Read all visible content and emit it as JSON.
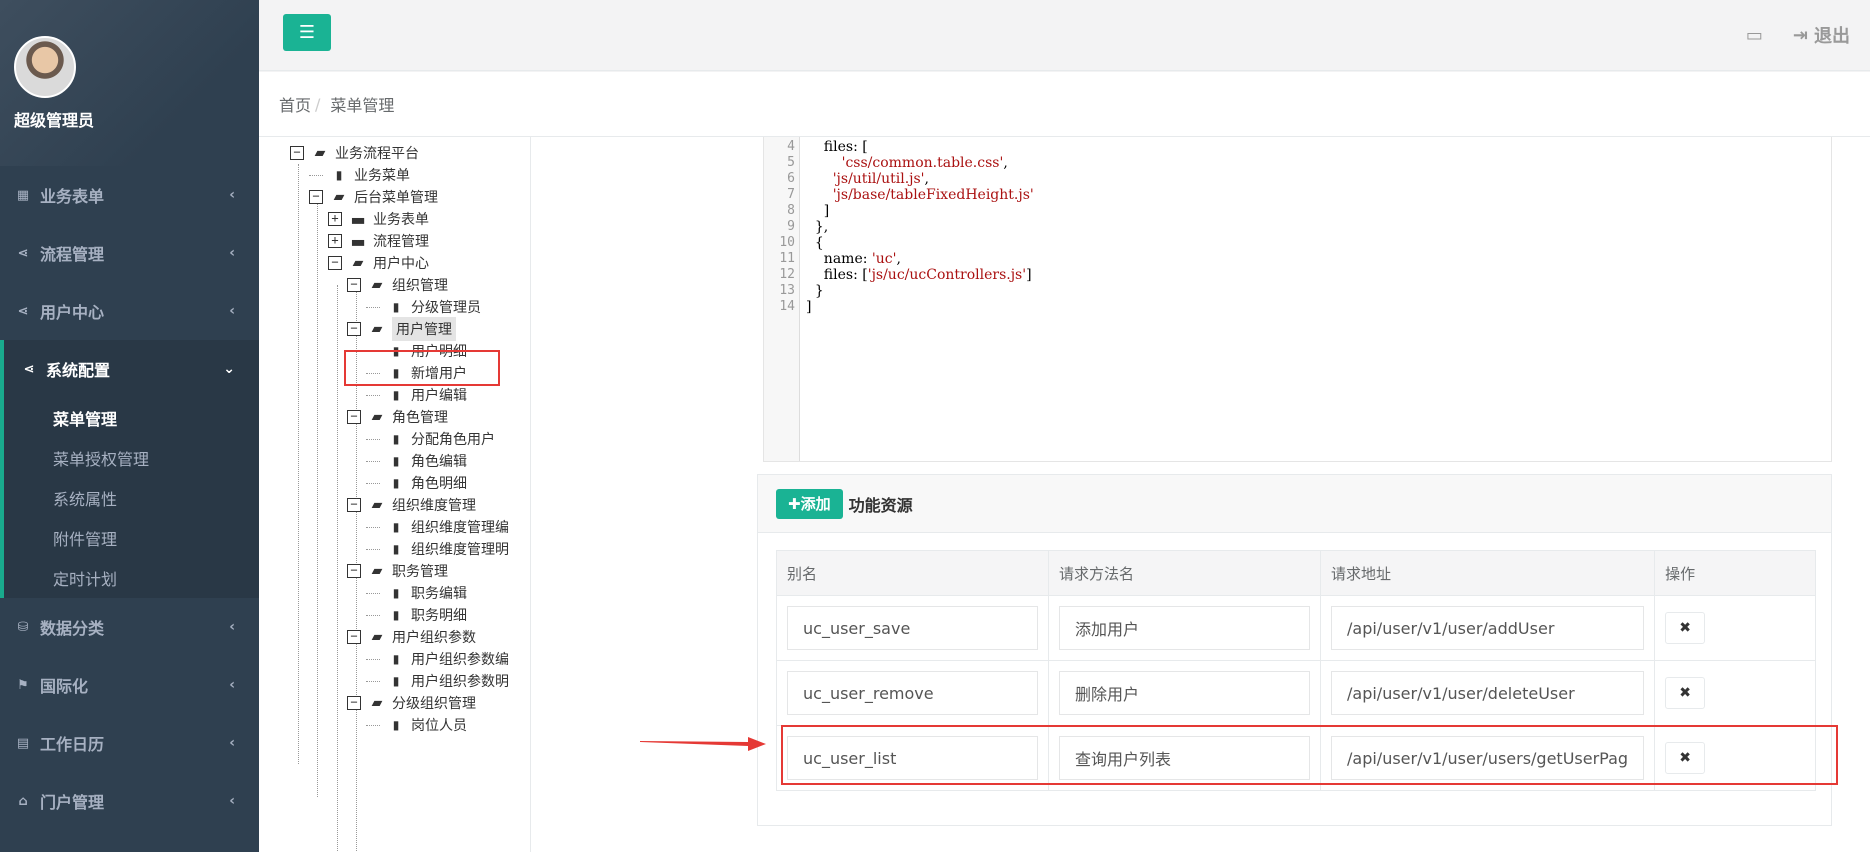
{
  "user": {
    "name": "超级管理员"
  },
  "sidebar": {
    "items": [
      {
        "label": "业务表单",
        "icon": "▦",
        "icon_name": "table-icon"
      },
      {
        "label": "流程管理",
        "icon": "⋖",
        "icon_name": "share-icon"
      },
      {
        "label": "用户中心",
        "icon": "⋖",
        "icon_name": "share-icon"
      },
      {
        "label": "系统配置",
        "icon": "⋖",
        "icon_name": "share-icon",
        "active": true,
        "children": [
          {
            "label": "菜单管理",
            "current": true
          },
          {
            "label": "菜单授权管理"
          },
          {
            "label": "系统属性"
          },
          {
            "label": "附件管理"
          },
          {
            "label": "定时计划"
          }
        ]
      },
      {
        "label": "数据分类",
        "icon": "⛁",
        "icon_name": "database-icon"
      },
      {
        "label": "国际化",
        "icon": "⚑",
        "icon_name": "language-icon"
      },
      {
        "label": "工作日历",
        "icon": "▤",
        "icon_name": "calendar-icon"
      },
      {
        "label": "门户管理",
        "icon": "⌂",
        "icon_name": "home-icon"
      }
    ]
  },
  "topbar": {
    "logout": "退出"
  },
  "breadcrumb": {
    "home": "首页",
    "current": "菜单管理"
  },
  "tree": [
    {
      "label": "业务流程平台",
      "type": "folder-open",
      "toggle": "−",
      "level": 0
    },
    {
      "label": "业务菜单",
      "type": "file",
      "level": 1
    },
    {
      "label": "后台菜单管理",
      "type": "folder-open",
      "toggle": "−",
      "level": 1
    },
    {
      "label": "业务表单",
      "type": "folder",
      "toggle": "+",
      "level": 2
    },
    {
      "label": "流程管理",
      "type": "folder",
      "toggle": "+",
      "level": 2
    },
    {
      "label": "用户中心",
      "type": "folder-open",
      "toggle": "−",
      "level": 2
    },
    {
      "label": "组织管理",
      "type": "folder-open",
      "toggle": "−",
      "level": 3
    },
    {
      "label": "分级管理员",
      "type": "file",
      "level": 4
    },
    {
      "label": "用户管理",
      "type": "folder-open",
      "toggle": "−",
      "level": 3,
      "selected": true
    },
    {
      "label": "用户明细",
      "type": "file",
      "level": 4
    },
    {
      "label": "新增用户",
      "type": "file",
      "level": 4
    },
    {
      "label": "用户编辑",
      "type": "file",
      "level": 4
    },
    {
      "label": "角色管理",
      "type": "folder-open",
      "toggle": "−",
      "level": 3
    },
    {
      "label": "分配角色用户",
      "type": "file",
      "level": 4
    },
    {
      "label": "角色编辑",
      "type": "file",
      "level": 4
    },
    {
      "label": "角色明细",
      "type": "file",
      "level": 4
    },
    {
      "label": "组织维度管理",
      "type": "folder-open",
      "toggle": "−",
      "level": 3
    },
    {
      "label": "组织维度管理编",
      "type": "file",
      "level": 4
    },
    {
      "label": "组织维度管理明",
      "type": "file",
      "level": 4
    },
    {
      "label": "职务管理",
      "type": "folder-open",
      "toggle": "−",
      "level": 3
    },
    {
      "label": "职务编辑",
      "type": "file",
      "level": 4
    },
    {
      "label": "职务明细",
      "type": "file",
      "level": 4
    },
    {
      "label": "用户组织参数",
      "type": "folder-open",
      "toggle": "−",
      "level": 3
    },
    {
      "label": "用户组织参数编",
      "type": "file",
      "level": 4
    },
    {
      "label": "用户组织参数明",
      "type": "file",
      "level": 4
    },
    {
      "label": "分级组织管理",
      "type": "folder-open",
      "toggle": "−",
      "level": 3
    },
    {
      "label": "岗位人员",
      "type": "file",
      "level": 4
    }
  ],
  "code": {
    "lines": [
      {
        "n": "4",
        "parts": [
          {
            "t": "    files: ["
          }
        ]
      },
      {
        "n": "5",
        "parts": [
          {
            "t": "        "
          },
          {
            "t": "'css/common.table.css'",
            "s": true
          },
          {
            "t": ","
          }
        ]
      },
      {
        "n": "6",
        "parts": [
          {
            "t": "      "
          },
          {
            "t": "'js/util/util.js'",
            "s": true
          },
          {
            "t": ","
          }
        ]
      },
      {
        "n": "7",
        "parts": [
          {
            "t": "      "
          },
          {
            "t": "'js/base/tableFixedHeight.js'",
            "s": true
          }
        ]
      },
      {
        "n": "8",
        "parts": [
          {
            "t": "    ]"
          }
        ]
      },
      {
        "n": "9",
        "parts": [
          {
            "t": "  },"
          }
        ]
      },
      {
        "n": "10",
        "parts": [
          {
            "t": "  {"
          }
        ]
      },
      {
        "n": "11",
        "parts": [
          {
            "t": "    name: "
          },
          {
            "t": "'uc'",
            "s": true
          },
          {
            "t": ","
          }
        ]
      },
      {
        "n": "12",
        "parts": [
          {
            "t": "    files: ["
          },
          {
            "t": "'js/uc/ucControllers.js'",
            "s": true
          },
          {
            "t": "]"
          }
        ]
      },
      {
        "n": "13",
        "parts": [
          {
            "t": "  }"
          }
        ]
      },
      {
        "n": "14",
        "parts": [
          {
            "t": "]"
          }
        ]
      }
    ]
  },
  "resources": {
    "add_label": "✚添加",
    "title": "功能资源",
    "columns": [
      "别名",
      "请求方法名",
      "请求地址",
      "操作"
    ],
    "rows": [
      {
        "alias": "uc_user_save",
        "method": "添加用户",
        "url": "/api/user/v1/user/addUser"
      },
      {
        "alias": "uc_user_remove",
        "method": "删除用户",
        "url": "/api/user/v1/user/deleteUser"
      },
      {
        "alias": "uc_user_list",
        "method": "查询用户列表",
        "url": "/api/user/v1/user/users/getUserPag"
      }
    ],
    "delete_icon": "✖"
  }
}
